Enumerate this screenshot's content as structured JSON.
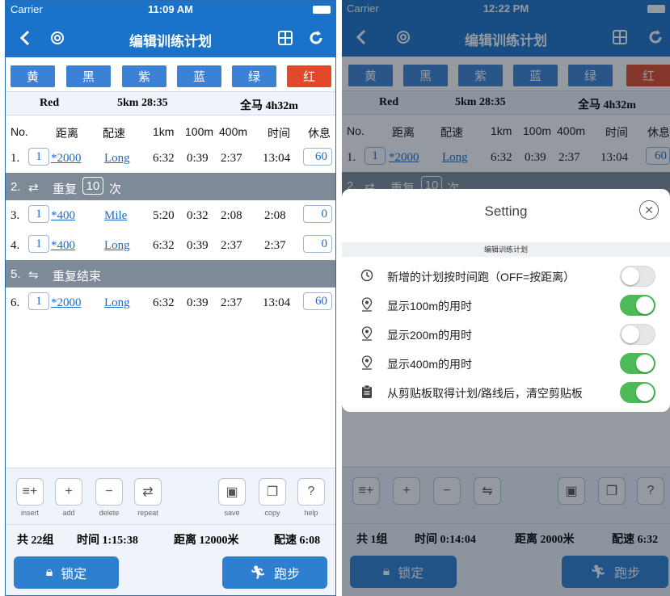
{
  "colors": {
    "primary": "#1b73c9",
    "button_blue": "#3b82d6",
    "button_red": "#e04a2a",
    "toggle_on": "#4cbb57",
    "row_group": "#7f8a99"
  },
  "status": {
    "carrier": "Carrier",
    "time_left": "11:09 AM",
    "time_right": "12:22 PM"
  },
  "nav": {
    "title": "编辑训练计划",
    "back_icon": "chevron-left-icon",
    "settings_icon": "gear-icon",
    "calc_icon": "calculator-icon",
    "refresh_icon": "refresh-icon"
  },
  "color_buttons": [
    {
      "label": "黄"
    },
    {
      "label": "黑"
    },
    {
      "label": "紫"
    },
    {
      "label": "蓝"
    },
    {
      "label": "绿"
    },
    {
      "label": "红"
    }
  ],
  "left": {
    "summary": {
      "name": "Red",
      "pace5k": "5km 28:35",
      "marathon": "全马 4h32m"
    },
    "headers": {
      "no": "No.",
      "distance": "距离",
      "pace": "配速",
      "km1": "1km",
      "m100": "100m",
      "m400": "400m",
      "time": "时间",
      "rest": "休息"
    },
    "rows": [
      {
        "no": "1.",
        "count": "1",
        "dist": "*2000",
        "pace": "Long",
        "k1": "6:32",
        "m100": "0:39",
        "m400": "2:37",
        "time": "13:04",
        "rest": "60"
      },
      {
        "no": "3.",
        "count": "1",
        "dist": "*400",
        "pace": "Mile",
        "k1": "5:20",
        "m100": "0:32",
        "m400": "2:08",
        "time": "2:08",
        "rest": "0"
      },
      {
        "no": "4.",
        "count": "1",
        "dist": "*400",
        "pace": "Long",
        "k1": "6:32",
        "m100": "0:39",
        "m400": "2:37",
        "time": "2:37",
        "rest": "0"
      },
      {
        "no": "6.",
        "count": "1",
        "dist": "*2000",
        "pace": "Long",
        "k1": "6:32",
        "m100": "0:39",
        "m400": "2:37",
        "time": "13:04",
        "rest": "60"
      }
    ],
    "repeat_start": {
      "no": "2.",
      "label": "重复",
      "times": "10",
      "suffix": "次"
    },
    "repeat_end": {
      "no": "5.",
      "label": "重复结束"
    },
    "totals": {
      "groups": "共 22组",
      "time": "时间 1:15:38",
      "distance": "距离 12000米",
      "pace": "配速 6:08"
    }
  },
  "tools": {
    "insert": "insert",
    "add": "add",
    "delete": "delete",
    "repeat": "repeat",
    "save": "save",
    "copy": "copy",
    "help": "help"
  },
  "buttons": {
    "lock": "锁定",
    "run": "跑步"
  },
  "right": {
    "summary": {
      "name": "Red",
      "pace5k": "5km 28:35",
      "marathon": "全马 4h32m"
    },
    "row1": {
      "no": "1.",
      "count": "1",
      "dist": "*2000",
      "pace": "Long",
      "k1": "6:32",
      "m100": "0:39",
      "m400": "2:37",
      "time": "13:04",
      "rest": "60"
    },
    "row2_peek": {
      "no": "2.",
      "label": "重复",
      "times": "10",
      "suffix": "次"
    },
    "totals": {
      "groups": "共 1组",
      "time": "时间 0:14:04",
      "distance": "距离 2000米",
      "pace": "配速 6:32"
    }
  },
  "dialog": {
    "title": "Setting",
    "section": "编辑训练计划",
    "items": [
      {
        "label": "新增的计划按时间跑（OFF=按距离）",
        "icon": "clock-icon",
        "on": false
      },
      {
        "label": "显示100m的用时",
        "icon": "location-pin-icon",
        "on": true
      },
      {
        "label": "显示200m的用时",
        "icon": "location-pin-icon",
        "on": false
      },
      {
        "label": "显示400m的用时",
        "icon": "location-pin-icon",
        "on": true
      },
      {
        "label": "从剪贴板取得计划/路线后，清空剪贴板",
        "icon": "clipboard-icon",
        "on": true
      }
    ]
  }
}
